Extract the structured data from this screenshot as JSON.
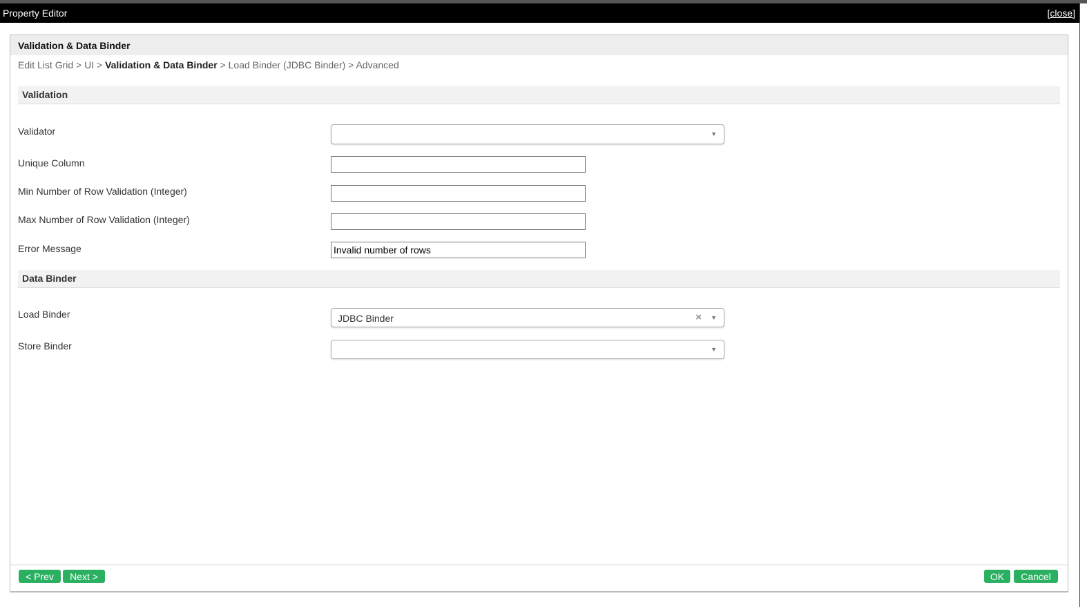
{
  "window": {
    "title": "Property Editor",
    "close": "[close]"
  },
  "panel": {
    "title": "Validation & Data Binder"
  },
  "breadcrumb": {
    "items": [
      "Edit List Grid",
      "UI"
    ],
    "current": "Validation & Data Binder",
    "after": [
      "Load Binder (JDBC Binder)",
      "Advanced"
    ],
    "sep": " > "
  },
  "validation": {
    "title": "Validation",
    "validator_label": "Validator",
    "validator_value": "",
    "unique_label": "Unique Column",
    "unique_value": "",
    "min_label": "Min Number of Row Validation (Integer)",
    "min_value": "",
    "max_label": "Max Number of Row Validation (Integer)",
    "max_value": "",
    "error_label": "Error Message",
    "error_value": "Invalid number of rows"
  },
  "binder": {
    "title": "Data Binder",
    "load_label": "Load Binder",
    "load_value": "JDBC Binder",
    "store_label": "Store Binder",
    "store_value": ""
  },
  "buttons": {
    "prev": "< Prev",
    "next": "Next >",
    "ok": "OK",
    "cancel": "Cancel"
  },
  "icons": {
    "clear": "×",
    "arrow": "▼"
  }
}
